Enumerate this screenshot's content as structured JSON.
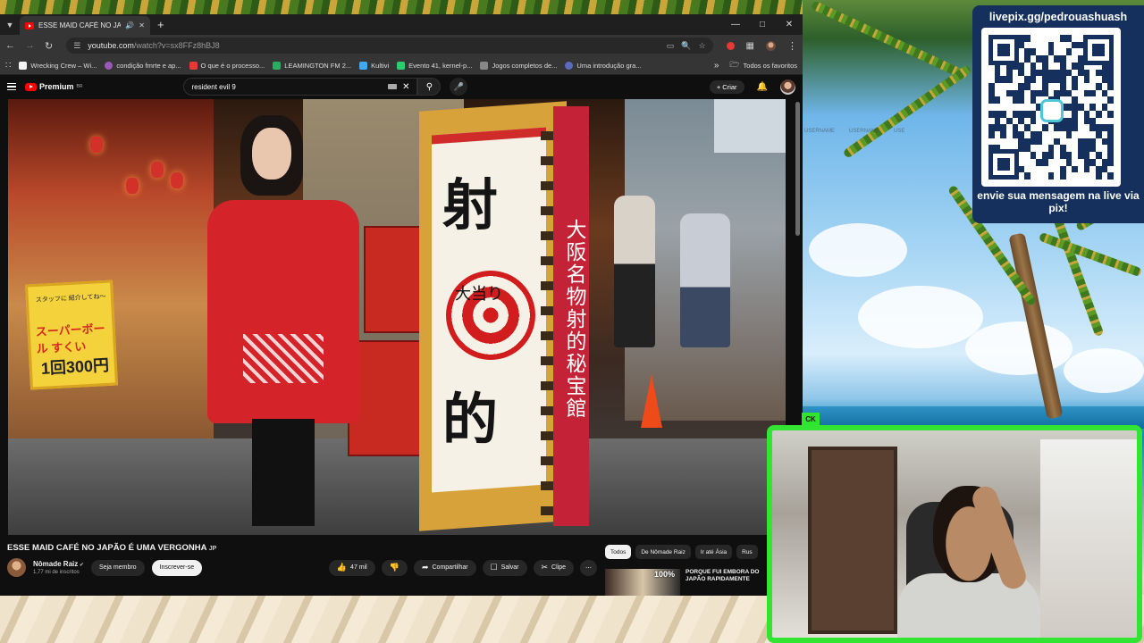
{
  "browser": {
    "tab_title": "ESSE MAID CAFÉ NO JAPÃO É UMA VERGONHA",
    "url_host": "youtube.com",
    "url_path": "/watch?v=sx8FFz8hBJ8",
    "bookmarks": [
      {
        "label": "Wrecking Crew – Wi...",
        "color": "#f4f4f4"
      },
      {
        "label": "condição fmrte e ap...",
        "color": "#9b59b6"
      },
      {
        "label": "O que é o processo...",
        "color": "#e53935"
      },
      {
        "label": "LEAMINGTON FM 2...",
        "color": "#27ae60"
      },
      {
        "label": "Kultivi",
        "color": "#3fa9f5"
      },
      {
        "label": "Evento 41, kernel-p...",
        "color": "#2ecc71"
      },
      {
        "label": "Jogos completos de...",
        "color": "#888888"
      },
      {
        "label": "Uma introdução gra...",
        "color": "#5c6bc0"
      }
    ],
    "all_favorites": "Todos os favoritos"
  },
  "youtube": {
    "logo_text": "Premium",
    "logo_sup": "BR",
    "search_query": "resident evil 9",
    "create_label": "Criar",
    "video_title": "ESSE MAID CAFÉ NO JAPÃO É UMA VERGONHA",
    "video_title_tag": "JP",
    "channel_name": "Nômade Raiz",
    "subscribers": "1,77 mi de inscritos",
    "join_label": "Seja membro",
    "subscribe_label": "Inscrever-se",
    "likes": "47 mil",
    "share_label": "Compartilhar",
    "save_label": "Salvar",
    "clip_label": "Clipe",
    "chips": [
      "Todos",
      "De Nômade Raiz",
      "Ir até Ásia",
      "Rus"
    ],
    "rec_badge": "100%",
    "rec_title": "PORQUE FUI EMBORA DO JAPÃO RAPIDAMENTE"
  },
  "video_scene": {
    "sign_yellow_line1": "スタッフに 紹介してね〜",
    "sign_yellow_line2": "スーパーボール すくい",
    "sign_yellow_price": "1回300円",
    "big_sign_kanji_top": "射",
    "big_sign_kanji_bottom": "的",
    "big_sign_center": "大当り",
    "side_banner": "大阪名物射的秘宝館"
  },
  "overlay": {
    "livepix_url": "livepix.gg/pedrouashuash",
    "pix_message": "envie sua mensagem na live via pix!",
    "ghost_usernames": [
      "USERNAME",
      "USERNAME",
      "USE"
    ],
    "cam_tag": "CK"
  }
}
